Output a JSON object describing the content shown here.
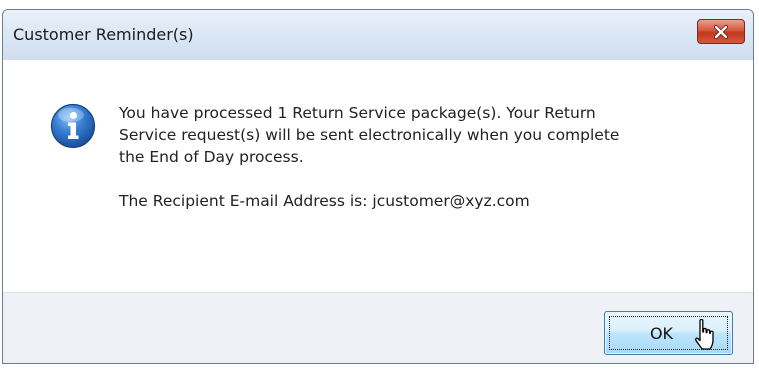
{
  "dialog": {
    "title": "Customer Reminder(s)",
    "close_icon": "close-icon",
    "message_icon": "info-icon",
    "message_line_1": "You have processed 1 Return Service package(s). Your Return",
    "message_line_2": "Service request(s) will be sent electronically when you complete",
    "message_line_3": "the End of Day process.",
    "recipient_text": "The Recipient E-mail Address is: jcustomer@xyz.com",
    "ok_label": "OK"
  },
  "colors": {
    "title_bar": "#dde8f5",
    "close_button": "#c2381f",
    "ok_button": "#bee6fd",
    "footer": "#f0f0f7",
    "info_icon": "#1c5fb8"
  },
  "cursor": {
    "icon": "hand-pointer-icon"
  }
}
